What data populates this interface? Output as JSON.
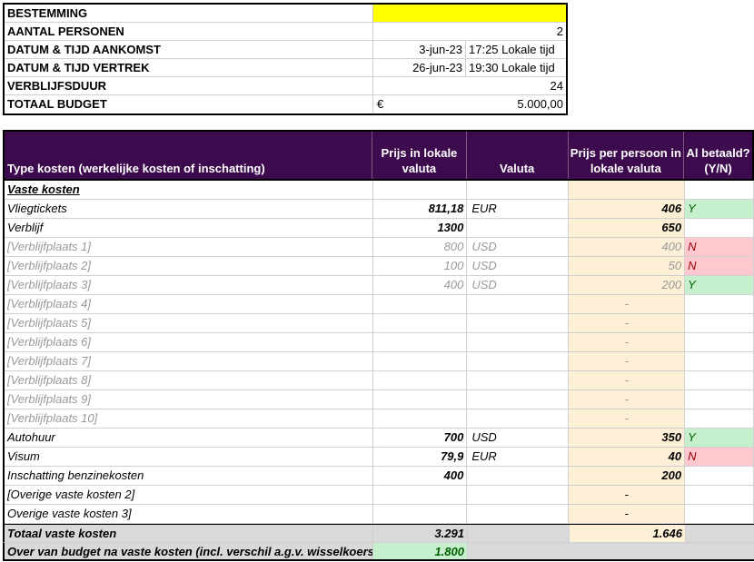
{
  "info": {
    "bestemming_label": "BESTEMMING",
    "aantal_label": "AANTAL PERSONEN",
    "aantal_value": "2",
    "aankomst_label": "DATUM & TIJD AANKOMST",
    "aankomst_date": "3-jun-23",
    "aankomst_time": "17:25 Lokale tijd",
    "vertrek_label": "DATUM & TIJD VERTREK",
    "vertrek_date": "26-jun-23",
    "vertrek_time": "19:30 Lokale tijd",
    "duur_label": "VERBLIJFSDUUR",
    "duur_value": "24",
    "budget_label": "TOTAAL BUDGET",
    "budget_currency": "€",
    "budget_value": "5.000,00"
  },
  "headers": {
    "type": "Type kosten (werkelijke kosten of inschatting)",
    "prijs_lokaal": "Prijs in lokale valuta",
    "valuta": "Valuta",
    "prijs_pp": "Prijs per persoon in lokale valuta",
    "betaald": "Al betaald? (Y/N)"
  },
  "section": "Vaste kosten",
  "rows": [
    {
      "type": "Vliegtickets",
      "prijs": "811,18",
      "valuta": "EUR",
      "pp": "406",
      "paid": "Y"
    },
    {
      "type": "Verblijf",
      "prijs": "1300",
      "valuta": "",
      "pp": "650",
      "paid": ""
    },
    {
      "type": "[Verblijfplaats 1]",
      "prijs": "800",
      "valuta": "USD",
      "pp": "400",
      "paid": "N"
    },
    {
      "type": "[Verblijfplaats 2]",
      "prijs": "100",
      "valuta": "USD",
      "pp": "50",
      "paid": "N"
    },
    {
      "type": "[Verblijfplaats 3]",
      "prijs": "400",
      "valuta": "USD",
      "pp": "200",
      "paid": "Y"
    },
    {
      "type": "[Verblijfplaats 4]",
      "prijs": "",
      "valuta": "",
      "pp": "-",
      "paid": ""
    },
    {
      "type": "[Verblijfplaats 5]",
      "prijs": "",
      "valuta": "",
      "pp": "-",
      "paid": ""
    },
    {
      "type": "[Verblijfplaats 6]",
      "prijs": "",
      "valuta": "",
      "pp": "-",
      "paid": ""
    },
    {
      "type": "[Verblijfplaats 7]",
      "prijs": "",
      "valuta": "",
      "pp": "-",
      "paid": ""
    },
    {
      "type": "[Verblijfplaats 8]",
      "prijs": "",
      "valuta": "",
      "pp": "-",
      "paid": ""
    },
    {
      "type": "[Verblijfplaats 9]",
      "prijs": "",
      "valuta": "",
      "pp": "-",
      "paid": ""
    },
    {
      "type": "[Verblijfplaats 10]",
      "prijs": "",
      "valuta": "",
      "pp": "-",
      "paid": ""
    },
    {
      "type": "Autohuur",
      "prijs": "700",
      "valuta": "USD",
      "pp": "350",
      "paid": "Y"
    },
    {
      "type": "Visum",
      "prijs": "79,9",
      "valuta": "EUR",
      "pp": "40",
      "paid": "N"
    },
    {
      "type": "Inschatting benzinekosten",
      "prijs": "400",
      "valuta": "",
      "pp": "200",
      "paid": ""
    },
    {
      "type": "[Overige vaste kosten 2]",
      "prijs": "",
      "valuta": "",
      "pp": "-",
      "paid": ""
    },
    {
      "type": "Overige vaste kosten 3]",
      "prijs": "",
      "valuta": "",
      "pp": "-",
      "paid": ""
    }
  ],
  "total": {
    "label": "Totaal vaste kosten",
    "prijs": "3.291",
    "pp": "1.646"
  },
  "over": {
    "label": "Over van budget na vaste kosten (incl. verschil a.g.v. wisselkoers)",
    "value": "1.800"
  },
  "colors": {
    "header_bg": "#3d0a4e",
    "pp_bg": "#fdf0d6",
    "yes_bg": "#c6efce",
    "no_bg": "#ffc7ce",
    "highlight": "#ffff00"
  }
}
